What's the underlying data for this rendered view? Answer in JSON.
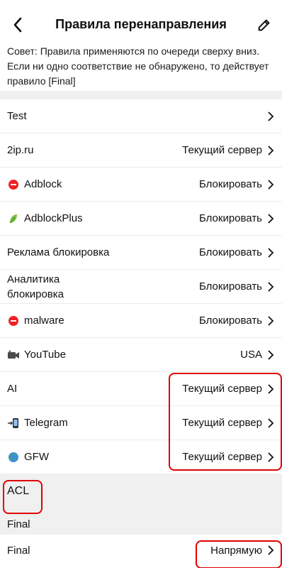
{
  "header": {
    "title": "Правила перенаправления",
    "back_icon": "chevron-left-icon",
    "edit_icon": "pencil-icon"
  },
  "tip": "Совет: Правила применяются по очереди сверху вниз. Если ни одно соответствие не обнаружено, то действует правило [Final]",
  "rules": [
    {
      "label": "Test",
      "icon": "",
      "value": ""
    },
    {
      "label": "2ip.ru",
      "icon": "",
      "value": "Текущий сервер"
    },
    {
      "label": "Adblock",
      "icon": "stop-sign-icon",
      "value": "Блокировать"
    },
    {
      "label": "AdblockPlus",
      "icon": "leaf-icon",
      "value": "Блокировать"
    },
    {
      "label": "Реклама блокировка",
      "icon": "",
      "value": "Блокировать"
    },
    {
      "label": "Аналитика блокировка",
      "icon": "",
      "value": "Блокировать"
    },
    {
      "label": "malware",
      "icon": "stop-sign-icon",
      "value": "Блокировать"
    },
    {
      "label": "YouTube",
      "icon": "video-camera-icon",
      "value": "USA"
    },
    {
      "label": "AI",
      "icon": "",
      "value": "Текущий сервер"
    },
    {
      "label": "Telegram",
      "icon": "mobile-arrow-icon",
      "value": "Текущий сервер"
    },
    {
      "label": "GFW",
      "icon": "globe-icon",
      "value": "Текущий сервер"
    }
  ],
  "acl": {
    "label": "ACL"
  },
  "final_section": {
    "title": "Final",
    "row": {
      "label": "Final",
      "value": "Напрямую"
    }
  },
  "colors": {
    "highlight": "#e00000",
    "background_gray": "#f0f0f0"
  }
}
